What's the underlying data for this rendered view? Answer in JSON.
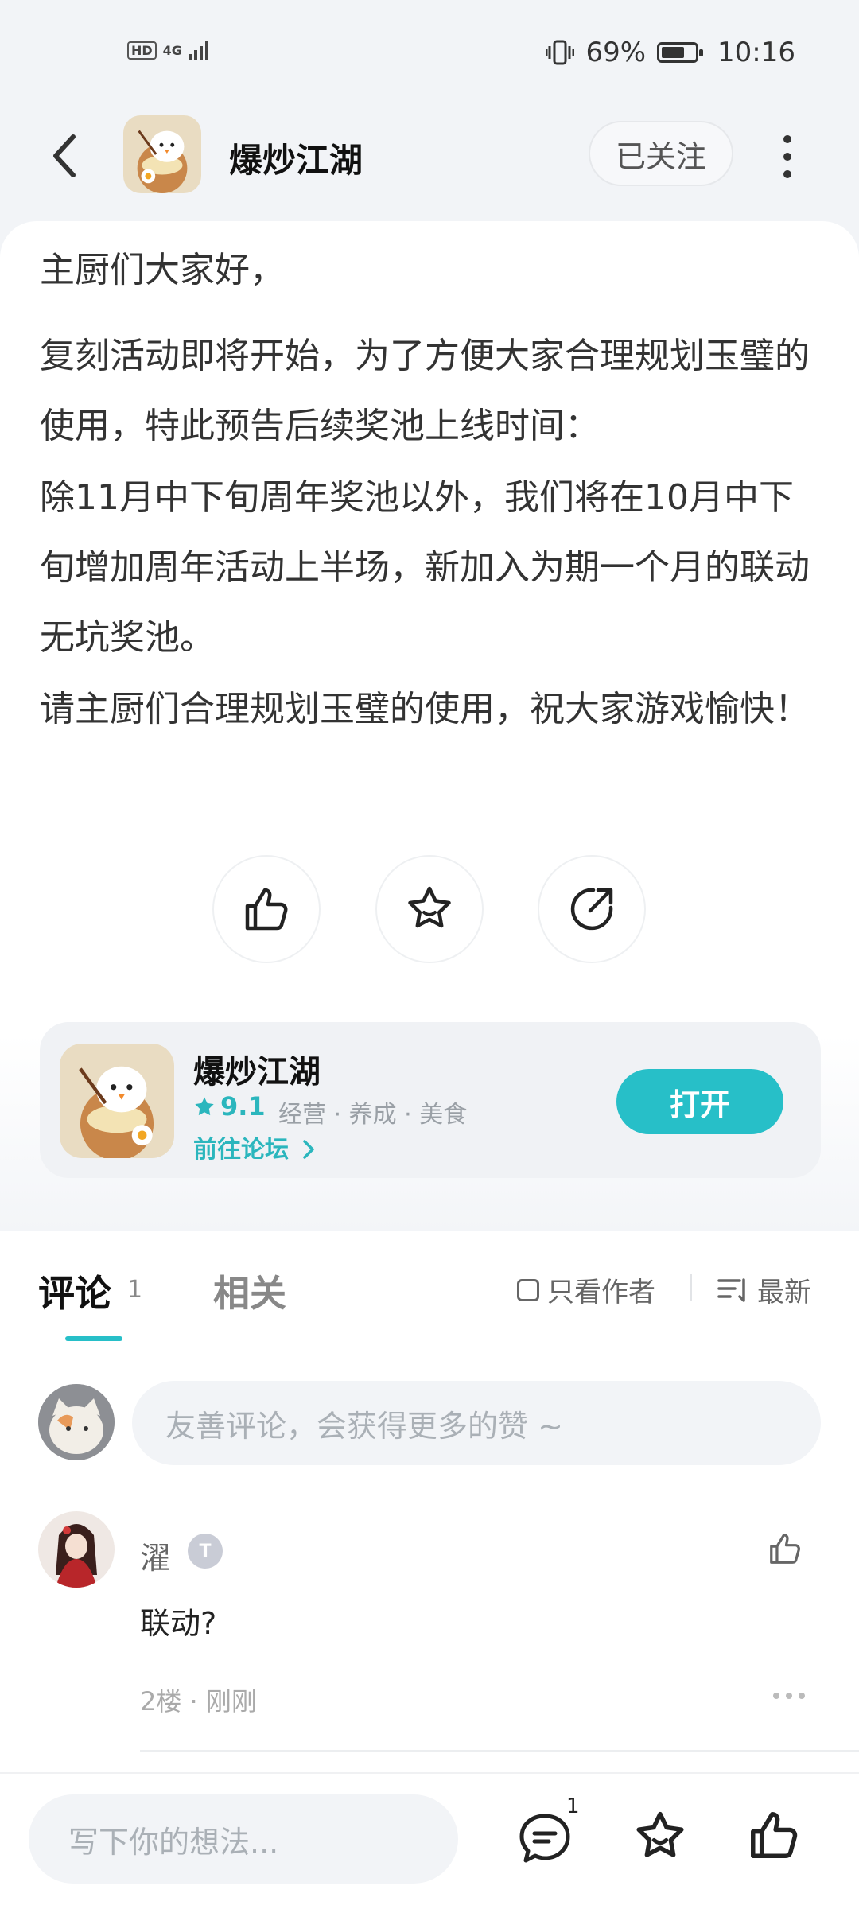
{
  "status_bar": {
    "hd": "HD",
    "network": "4G",
    "battery": "69%",
    "battery_level": 0.69,
    "time": "10:16"
  },
  "header": {
    "title": "爆炒江湖",
    "follow_label": "已关注"
  },
  "post": {
    "paragraphs": [
      "主厨们大家好，",
      "复刻活动即将开始，为了方便大家合理规划玉璧的使用，特此预告后续奖池上线时间：",
      "除11月中下旬周年奖池以外，我们将在10月中下旬增加周年活动上半场，新加入为期一个月的联动无坑奖池。",
      "请主厨们合理规划玉璧的使用，祝大家游戏愉快！"
    ]
  },
  "app_card": {
    "name": "爆炒江湖",
    "rating": "9.1",
    "tags": "经营 · 养成 · 美食",
    "forum_link": "前往论坛",
    "open_label": "打开"
  },
  "tabs": {
    "comments_label": "评论",
    "comments_count": "1",
    "related_label": "相关",
    "only_author": "只看作者",
    "sort_label": "最新"
  },
  "comment_box": {
    "placeholder": "友善评论，会获得更多的赞 ~"
  },
  "comments": [
    {
      "user": "濯",
      "badge": "T",
      "text": "联动?",
      "floor": "2楼",
      "time": "刚刚",
      "meta": "2楼 · 刚刚"
    }
  ],
  "bottom_bar": {
    "placeholder": "写下你的想法...",
    "comment_count": "1"
  }
}
